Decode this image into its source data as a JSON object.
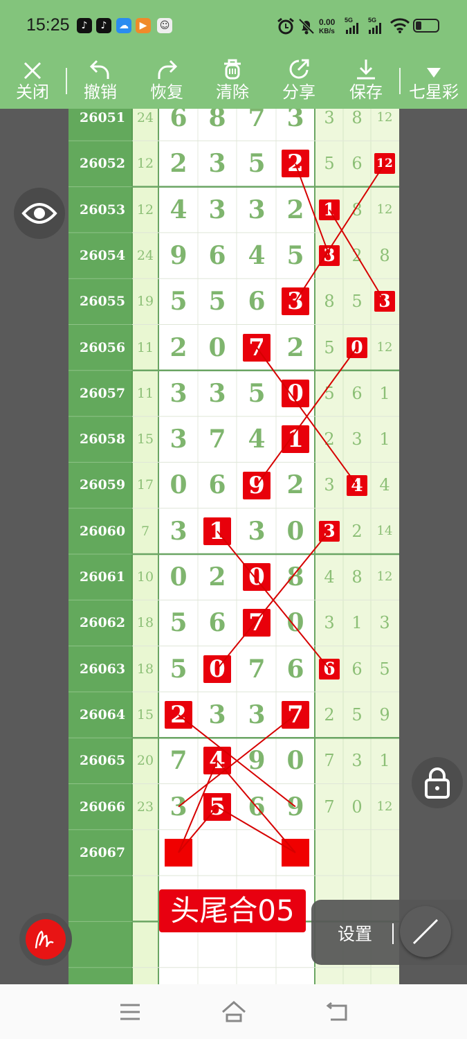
{
  "status_bar": {
    "time": "15:25",
    "net_speed_value": "0.00",
    "net_speed_unit": "KB/s",
    "signal1": "5G",
    "signal2": "5G"
  },
  "toolbar": {
    "close": "关闭",
    "undo": "撤销",
    "redo": "恢复",
    "clear": "清除",
    "share": "分享",
    "save": "保存",
    "lottery": "七星彩"
  },
  "rows": [
    {
      "period": "26051",
      "sum": "24",
      "digits": [
        "6",
        "8",
        "7",
        "3"
      ],
      "tails": [
        "3",
        "8",
        "12"
      ]
    },
    {
      "period": "26052",
      "sum": "12",
      "digits": [
        "2",
        "3",
        "5",
        "2"
      ],
      "tails": [
        "5",
        "6",
        "12"
      ]
    },
    {
      "period": "26053",
      "sum": "12",
      "digits": [
        "4",
        "3",
        "3",
        "2"
      ],
      "tails": [
        "1",
        "8",
        "12"
      ]
    },
    {
      "period": "26054",
      "sum": "24",
      "digits": [
        "9",
        "6",
        "4",
        "5"
      ],
      "tails": [
        "3",
        "2",
        "8"
      ]
    },
    {
      "period": "26055",
      "sum": "19",
      "digits": [
        "5",
        "5",
        "6",
        "3"
      ],
      "tails": [
        "8",
        "5",
        "3"
      ]
    },
    {
      "period": "26056",
      "sum": "11",
      "digits": [
        "2",
        "0",
        "7",
        "2"
      ],
      "tails": [
        "5",
        "0",
        "12"
      ]
    },
    {
      "period": "26057",
      "sum": "11",
      "digits": [
        "3",
        "3",
        "5",
        "0"
      ],
      "tails": [
        "5",
        "6",
        "1"
      ]
    },
    {
      "period": "26058",
      "sum": "15",
      "digits": [
        "3",
        "7",
        "4",
        "1"
      ],
      "tails": [
        "2",
        "3",
        "1"
      ]
    },
    {
      "period": "26059",
      "sum": "17",
      "digits": [
        "0",
        "6",
        "9",
        "2"
      ],
      "tails": [
        "3",
        "4",
        "4"
      ]
    },
    {
      "period": "26060",
      "sum": "7",
      "digits": [
        "3",
        "1",
        "3",
        "0"
      ],
      "tails": [
        "3",
        "2",
        "14"
      ]
    },
    {
      "period": "26061",
      "sum": "10",
      "digits": [
        "0",
        "2",
        "0",
        "8"
      ],
      "tails": [
        "4",
        "8",
        "12"
      ]
    },
    {
      "period": "26062",
      "sum": "18",
      "digits": [
        "5",
        "6",
        "7",
        "0"
      ],
      "tails": [
        "3",
        "1",
        "3"
      ]
    },
    {
      "period": "26063",
      "sum": "18",
      "digits": [
        "5",
        "0",
        "7",
        "6"
      ],
      "tails": [
        "6",
        "6",
        "5"
      ]
    },
    {
      "period": "26064",
      "sum": "15",
      "digits": [
        "2",
        "3",
        "3",
        "7"
      ],
      "tails": [
        "2",
        "5",
        "9"
      ]
    },
    {
      "period": "26065",
      "sum": "20",
      "digits": [
        "7",
        "4",
        "9",
        "0"
      ],
      "tails": [
        "7",
        "3",
        "1"
      ]
    },
    {
      "period": "26066",
      "sum": "23",
      "digits": [
        "3",
        "5",
        "6",
        "9"
      ],
      "tails": [
        "7",
        "0",
        "12"
      ]
    },
    {
      "period": "26067",
      "sum": "",
      "digits": [
        "",
        "",
        "",
        ""
      ],
      "tails": [
        "",
        "",
        ""
      ]
    }
  ],
  "highlights": [
    {
      "row": 1,
      "col": "d3"
    },
    {
      "row": 1,
      "col": "t2"
    },
    {
      "row": 2,
      "col": "t0"
    },
    {
      "row": 3,
      "col": "t0"
    },
    {
      "row": 4,
      "col": "d3"
    },
    {
      "row": 4,
      "col": "t2"
    },
    {
      "row": 5,
      "col": "d2"
    },
    {
      "row": 5,
      "col": "t1"
    },
    {
      "row": 6,
      "col": "d3"
    },
    {
      "row": 7,
      "col": "d3"
    },
    {
      "row": 8,
      "col": "d2"
    },
    {
      "row": 8,
      "col": "t1"
    },
    {
      "row": 9,
      "col": "d1"
    },
    {
      "row": 9,
      "col": "t0"
    },
    {
      "row": 10,
      "col": "d2"
    },
    {
      "row": 11,
      "col": "d2"
    },
    {
      "row": 12,
      "col": "d1"
    },
    {
      "row": 12,
      "col": "t0"
    },
    {
      "row": 13,
      "col": "d0"
    },
    {
      "row": 13,
      "col": "d3"
    },
    {
      "row": 14,
      "col": "d1"
    },
    {
      "row": 15,
      "col": "d1"
    }
  ],
  "blank_marks": [
    {
      "row": 16,
      "col": "d0"
    },
    {
      "row": 16,
      "col": "d3"
    }
  ],
  "prediction_label": "头尾合05",
  "settings_label": "设置",
  "colors": {
    "accent_green": "#83c47c",
    "period_green": "#63a95c",
    "mark_red": "#e8000b"
  },
  "icons": [
    "close-icon",
    "undo-icon",
    "redo-icon",
    "clear-icon",
    "share-icon",
    "save-icon",
    "dropdown-icon",
    "eye-icon",
    "lock-icon",
    "pen-icon",
    "line-tool-icon",
    "menu-icon",
    "home-icon",
    "back-icon"
  ]
}
